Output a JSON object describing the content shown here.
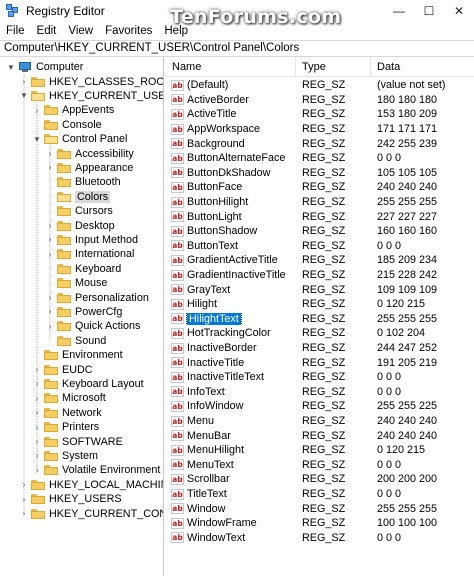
{
  "window": {
    "title": "Registry Editor",
    "watermark": "TenForums.com",
    "minimize_glyph": "—",
    "maximize_glyph": "☐",
    "close_glyph": "✕"
  },
  "menu": [
    {
      "label": "File"
    },
    {
      "label": "Edit"
    },
    {
      "label": "View"
    },
    {
      "label": "Favorites"
    },
    {
      "label": "Help"
    }
  ],
  "address": "Computer\\HKEY_CURRENT_USER\\Control Panel\\Colors",
  "tree": [
    {
      "label": "Computer",
      "icon": "computer-icon",
      "expander": "▼",
      "level": 0
    },
    {
      "label": "HKEY_CLASSES_ROOT",
      "icon": "folder-icon",
      "expander": "›",
      "level": 1
    },
    {
      "label": "HKEY_CURRENT_USER",
      "icon": "folder-icon",
      "expander": "▼",
      "level": 1
    },
    {
      "label": "AppEvents",
      "icon": "folder-icon",
      "expander": "›",
      "level": 2
    },
    {
      "label": "Console",
      "icon": "folder-icon",
      "expander": "",
      "level": 2
    },
    {
      "label": "Control Panel",
      "icon": "folder-icon",
      "expander": "▼",
      "level": 2
    },
    {
      "label": "Accessibility",
      "icon": "folder-icon",
      "expander": "›",
      "level": 3
    },
    {
      "label": "Appearance",
      "icon": "folder-icon",
      "expander": "›",
      "level": 3
    },
    {
      "label": "Bluetooth",
      "icon": "folder-icon",
      "expander": "",
      "level": 3
    },
    {
      "label": "Colors",
      "icon": "folder-icon",
      "expander": "",
      "level": 3,
      "selected": true
    },
    {
      "label": "Cursors",
      "icon": "folder-icon",
      "expander": "",
      "level": 3
    },
    {
      "label": "Desktop",
      "icon": "folder-icon",
      "expander": "›",
      "level": 3
    },
    {
      "label": "Input Method",
      "icon": "folder-icon",
      "expander": "›",
      "level": 3
    },
    {
      "label": "International",
      "icon": "folder-icon",
      "expander": "›",
      "level": 3
    },
    {
      "label": "Keyboard",
      "icon": "folder-icon",
      "expander": "",
      "level": 3
    },
    {
      "label": "Mouse",
      "icon": "folder-icon",
      "expander": "",
      "level": 3
    },
    {
      "label": "Personalization",
      "icon": "folder-icon",
      "expander": "›",
      "level": 3
    },
    {
      "label": "PowerCfg",
      "icon": "folder-icon",
      "expander": "›",
      "level": 3
    },
    {
      "label": "Quick Actions",
      "icon": "folder-icon",
      "expander": "›",
      "level": 3
    },
    {
      "label": "Sound",
      "icon": "folder-icon",
      "expander": "",
      "level": 3
    },
    {
      "label": "Environment",
      "icon": "folder-icon",
      "expander": "",
      "level": 2
    },
    {
      "label": "EUDC",
      "icon": "folder-icon",
      "expander": "›",
      "level": 2
    },
    {
      "label": "Keyboard Layout",
      "icon": "folder-icon",
      "expander": "›",
      "level": 2
    },
    {
      "label": "Microsoft",
      "icon": "folder-icon",
      "expander": "›",
      "level": 2
    },
    {
      "label": "Network",
      "icon": "folder-icon",
      "expander": "›",
      "level": 2
    },
    {
      "label": "Printers",
      "icon": "folder-icon",
      "expander": "›",
      "level": 2
    },
    {
      "label": "SOFTWARE",
      "icon": "folder-icon",
      "expander": "›",
      "level": 2
    },
    {
      "label": "System",
      "icon": "folder-icon",
      "expander": "›",
      "level": 2
    },
    {
      "label": "Volatile Environment",
      "icon": "folder-icon",
      "expander": "›",
      "level": 2
    },
    {
      "label": "HKEY_LOCAL_MACHINE",
      "icon": "folder-icon",
      "expander": "›",
      "level": 1
    },
    {
      "label": "HKEY_USERS",
      "icon": "folder-icon",
      "expander": "›",
      "level": 1
    },
    {
      "label": "HKEY_CURRENT_CONFIG",
      "icon": "folder-icon",
      "expander": "›",
      "level": 1
    }
  ],
  "list": {
    "columns": {
      "name": "Name",
      "type": "Type",
      "data": "Data"
    },
    "icon_text": "ab",
    "rows": [
      {
        "name": "(Default)",
        "type": "REG_SZ",
        "data": "(value not set)"
      },
      {
        "name": "ActiveBorder",
        "type": "REG_SZ",
        "data": "180 180 180"
      },
      {
        "name": "ActiveTitle",
        "type": "REG_SZ",
        "data": "153 180 209"
      },
      {
        "name": "AppWorkspace",
        "type": "REG_SZ",
        "data": "171 171 171"
      },
      {
        "name": "Background",
        "type": "REG_SZ",
        "data": "242 255 239"
      },
      {
        "name": "ButtonAlternateFace",
        "type": "REG_SZ",
        "data": "0 0 0"
      },
      {
        "name": "ButtonDkShadow",
        "type": "REG_SZ",
        "data": "105 105 105"
      },
      {
        "name": "ButtonFace",
        "type": "REG_SZ",
        "data": "240 240 240"
      },
      {
        "name": "ButtonHilight",
        "type": "REG_SZ",
        "data": "255 255 255"
      },
      {
        "name": "ButtonLight",
        "type": "REG_SZ",
        "data": "227 227 227"
      },
      {
        "name": "ButtonShadow",
        "type": "REG_SZ",
        "data": "160 160 160"
      },
      {
        "name": "ButtonText",
        "type": "REG_SZ",
        "data": "0 0 0"
      },
      {
        "name": "GradientActiveTitle",
        "type": "REG_SZ",
        "data": "185 209 234"
      },
      {
        "name": "GradientInactiveTitle",
        "type": "REG_SZ",
        "data": "215 228 242"
      },
      {
        "name": "GrayText",
        "type": "REG_SZ",
        "data": "109 109 109"
      },
      {
        "name": "Hilight",
        "type": "REG_SZ",
        "data": "0 120 215"
      },
      {
        "name": "HilightText",
        "type": "REG_SZ",
        "data": "255 255 255",
        "selected": true
      },
      {
        "name": "HotTrackingColor",
        "type": "REG_SZ",
        "data": "0 102 204"
      },
      {
        "name": "InactiveBorder",
        "type": "REG_SZ",
        "data": "244 247 252"
      },
      {
        "name": "InactiveTitle",
        "type": "REG_SZ",
        "data": "191 205 219"
      },
      {
        "name": "InactiveTitleText",
        "type": "REG_SZ",
        "data": "0 0 0"
      },
      {
        "name": "InfoText",
        "type": "REG_SZ",
        "data": "0 0 0"
      },
      {
        "name": "InfoWindow",
        "type": "REG_SZ",
        "data": "255 255 225"
      },
      {
        "name": "Menu",
        "type": "REG_SZ",
        "data": "240 240 240"
      },
      {
        "name": "MenuBar",
        "type": "REG_SZ",
        "data": "240 240 240"
      },
      {
        "name": "MenuHilight",
        "type": "REG_SZ",
        "data": "0 120 215"
      },
      {
        "name": "MenuText",
        "type": "REG_SZ",
        "data": "0 0 0"
      },
      {
        "name": "Scrollbar",
        "type": "REG_SZ",
        "data": "200 200 200"
      },
      {
        "name": "TitleText",
        "type": "REG_SZ",
        "data": "0 0 0"
      },
      {
        "name": "Window",
        "type": "REG_SZ",
        "data": "255 255 255"
      },
      {
        "name": "WindowFrame",
        "type": "REG_SZ",
        "data": "100 100 100"
      },
      {
        "name": "WindowText",
        "type": "REG_SZ",
        "data": "0 0 0"
      }
    ]
  },
  "colors": {
    "selection": "#0078d7",
    "tree_selection": "#d9d9d9",
    "folder": "#f6cd63",
    "string_icon": "#c02020"
  }
}
